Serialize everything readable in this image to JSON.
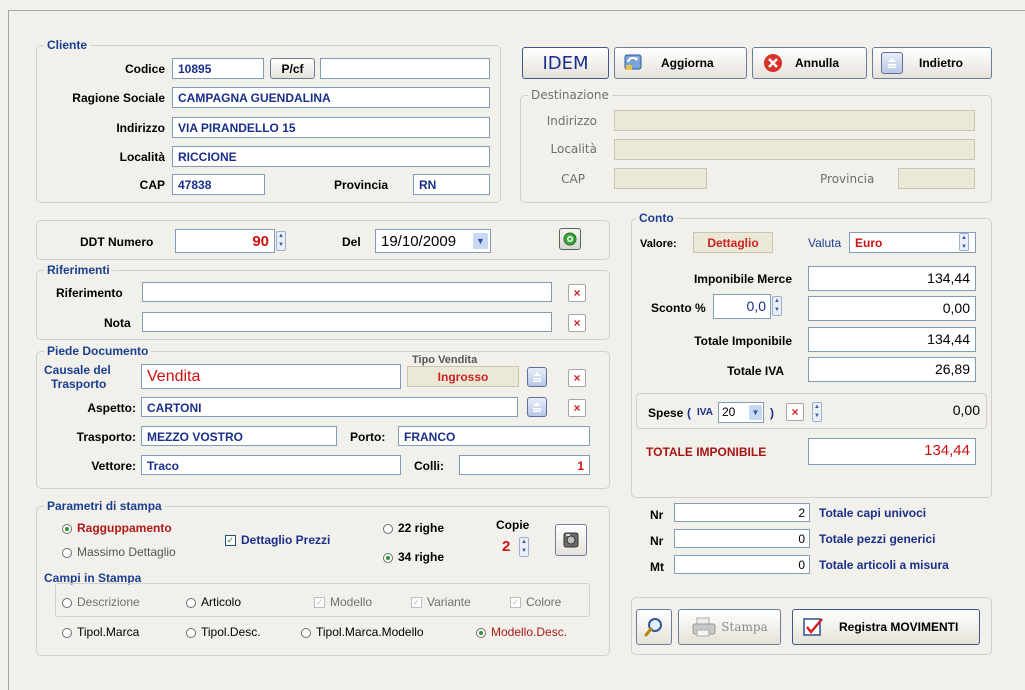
{
  "cliente": {
    "legend": "Cliente",
    "codice_label": "Codice",
    "codice_value": "10895",
    "pcf_label": "P/cf",
    "pcf_value": "",
    "ragione_label": "Ragione Sociale",
    "ragione_value": "CAMPAGNA  GUENDALINA",
    "indirizzo_label": "Indirizzo",
    "indirizzo_value": "VIA PIRANDELLO 15",
    "localita_label": "Località",
    "localita_value": "RICCIONE",
    "cap_label": "CAP",
    "cap_value": "47838",
    "provincia_label": "Provincia",
    "provincia_value": "RN"
  },
  "toolbar": {
    "idem": "IDEM",
    "aggiorna": "Aggiorna",
    "annulla": "Annulla",
    "indietro": "Indietro"
  },
  "destinazione": {
    "legend": "Destinazione",
    "indirizzo_label": "Indirizzo",
    "localita_label": "Località",
    "cap_label": "CAP",
    "provincia_label": "Provincia"
  },
  "ddt": {
    "numero_label": "DDT Numero",
    "numero_value": "90",
    "del_label": "Del",
    "del_value": "19/10/2009"
  },
  "riferimenti": {
    "legend": "Riferimenti",
    "riferimento_label": "Riferimento",
    "nota_label": "Nota"
  },
  "piede": {
    "legend": "Piede Documento",
    "tipo_vendita_label": "Tipo Vendita",
    "tipo_vendita_value": "Ingrosso",
    "causale_label_1": "Causale del",
    "causale_label_2": "Trasporto",
    "causale_value": "Vendita",
    "aspetto_label": "Aspetto:",
    "aspetto_value": "CARTONI",
    "trasporto_label": "Trasporto:",
    "trasporto_value": "MEZZO VOSTRO",
    "porto_label": "Porto:",
    "porto_value": "FRANCO",
    "vettore_label": "Vettore:",
    "vettore_value": "Traco",
    "colli_label": "Colli:",
    "colli_value": "1"
  },
  "stampa": {
    "legend": "Parametri di stampa",
    "raggruppamento": "Ragguppamento",
    "massimo": "Massimo Dettaglio",
    "dettaglio_prezzi": "Dettaglio Prezzi",
    "righe22": "22 righe",
    "righe34": "34 righe",
    "copie_label": "Copie",
    "copie_value": "2",
    "campi_legend": "Campi in Stampa",
    "descrizione": "Descrizione",
    "articolo": "Articolo",
    "modello": "Modello",
    "variante": "Variante",
    "colore": "Colore",
    "tipol_marca": "Tipol.Marca",
    "tipol_desc": "Tipol.Desc.",
    "tipol_marca_modello": "Tipol.Marca.Modello",
    "modello_desc": "Modello.Desc."
  },
  "conto": {
    "legend": "Conto",
    "valore_label": "Valore:",
    "valore_value": "Dettaglio",
    "valuta_label": "Valuta",
    "valuta_value": "Euro",
    "imponibile_merce_label": "Imponibile Merce",
    "imponibile_merce_value": "134,44",
    "sconto_label": "Sconto %",
    "sconto_perc": "0,0",
    "sconto_value": "0,00",
    "totale_imponibile_label": "Totale Imponibile",
    "totale_imponibile_value": "134,44",
    "totale_iva_label": "Totale IVA",
    "totale_iva_value": "26,89",
    "spese_label": "Spese",
    "spese_iva_label": "IVA",
    "spese_iva_value": "20",
    "spese_value": "0,00",
    "totale_finale_label": "TOTALE IMPONIBILE",
    "totale_finale_value": "134,44"
  },
  "totali": {
    "nr_label": "Nr",
    "mt_label": "Mt",
    "capi_value": "2",
    "capi_label": "Totale capi univoci",
    "pezzi_value": "0",
    "pezzi_label": "Totale pezzi generici",
    "articoli_value": "0",
    "articoli_label": "Totale articoli a misura"
  },
  "azioni": {
    "stampa": "Stampa",
    "registra": "Registra MOVIMENTI"
  }
}
